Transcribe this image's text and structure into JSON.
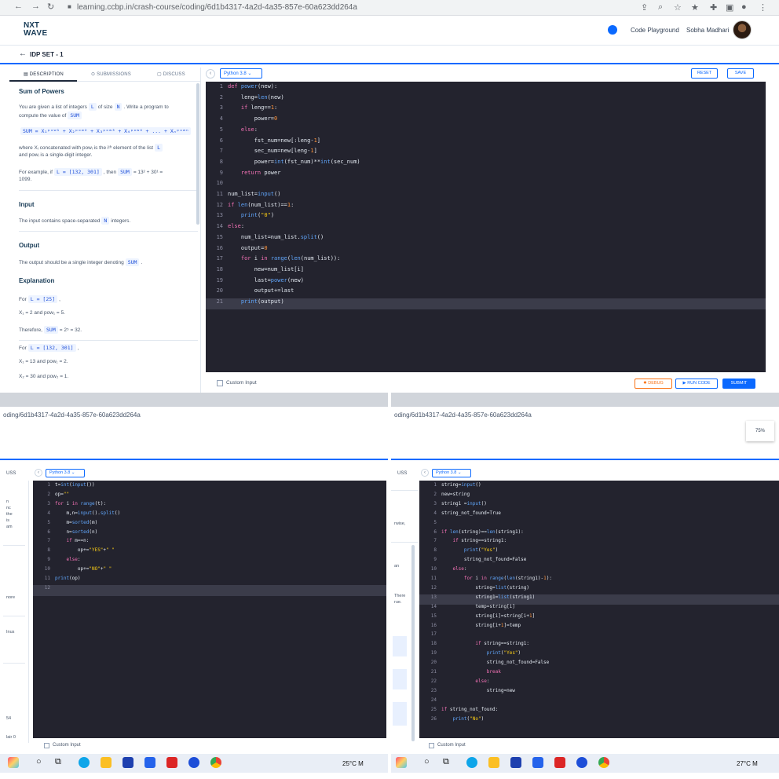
{
  "browser": {
    "url": "learning.ccbp.in/crash-course/coding/6d1b4317-4a2d-4a35-857e-60a623dd264a"
  },
  "header": {
    "logo_line1": "NXT",
    "logo_line2": "WAVE",
    "playground_label": "Code Playground",
    "username": "Sobha Madhari"
  },
  "page": {
    "title": "IDP SET - 1"
  },
  "tabs": [
    {
      "label": "DESCRIPTION"
    },
    {
      "label": "SUBMISSIONS"
    },
    {
      "label": "DISCUSS"
    }
  ],
  "problem": {
    "title": "Sum of Powers",
    "intro_a": "You are given a list of integers",
    "intro_L": "L",
    "intro_b": "of size",
    "intro_N": "N",
    "intro_c": ". Write a program to",
    "intro_d": "compute the value of",
    "intro_SUM": "SUM",
    "formula": "SUM  = X₁ᵖᵒʷ¹ + X₂ᵖᵒʷ² + X₃ᵖᵒʷ³ + X₄ᵖᵒʷ⁴ + ... + Xₙᵖᵒʷⁿ",
    "where_a": "where Xᵢ concatenated with powᵢ is the iᵗʰ element of the list",
    "where_L": "L",
    "where_b": "and powᵢ is a single-digit integer.",
    "example_a": "For example, if",
    "example_L": "L = [132, 301]",
    "example_b": ", then",
    "example_SUM": "SUM",
    "example_c": "= 13² + 30¹ =",
    "example_d": "1099.",
    "input_heading": "Input",
    "input_a": "The input contains space-separated",
    "input_N": "N",
    "input_b": "integers.",
    "output_heading": "Output",
    "output_a": "The output should be a single integer denoting",
    "output_SUM": "SUM",
    "output_b": ".",
    "explanation_heading": "Explanation",
    "exp1_a": "For",
    "exp1_L": "L = [25]",
    "exp1_b": ",",
    "exp2": "X₁ = 2 and pow₁ = 5.",
    "exp3_a": "Therefore,",
    "exp3_SUM": "SUM",
    "exp3_b": "= 2⁵ = 32.",
    "exp4_a": "For",
    "exp4_L": "L = [132, 301]",
    "exp4_b": ",",
    "exp5": "X₁ = 13 and pow₁ = 2.",
    "exp6": "X₂ = 30 and pow₂ = 1."
  },
  "toolbar": {
    "language": "Python 3.8",
    "reset_label": "RESET",
    "save_label": "SAVE"
  },
  "editor_main": {
    "active_line": 21,
    "lines": [
      {
        "n": "1",
        "t": "def power(new):"
      },
      {
        "n": "2",
        "t": "    leng=len(new)"
      },
      {
        "n": "3",
        "t": "    if leng==1:"
      },
      {
        "n": "4",
        "t": "        power=0"
      },
      {
        "n": "5",
        "t": "    else:"
      },
      {
        "n": "6",
        "t": "        fst_num=new[:leng-1]"
      },
      {
        "n": "7",
        "t": "        sec_num=new[leng-1]"
      },
      {
        "n": "8",
        "t": "        power=int(fst_num)**int(sec_num)"
      },
      {
        "n": "9",
        "t": "    return power"
      },
      {
        "n": "10",
        "t": ""
      },
      {
        "n": "11",
        "t": "num_list=input()"
      },
      {
        "n": "12",
        "t": "if len(num_list)==1:"
      },
      {
        "n": "13",
        "t": "    print(\"0\")"
      },
      {
        "n": "14",
        "t": "else:"
      },
      {
        "n": "15",
        "t": "    num_list=num_list.split()"
      },
      {
        "n": "16",
        "t": "    output=0"
      },
      {
        "n": "17",
        "t": "    for i in range(len(num_list)):"
      },
      {
        "n": "18",
        "t": "        new=num_list[i]"
      },
      {
        "n": "19",
        "t": "        last=power(new)"
      },
      {
        "n": "20",
        "t": "        output+=last"
      },
      {
        "n": "21",
        "t": "    print(output)"
      }
    ]
  },
  "footer_main": {
    "custom_input": "Custom Input",
    "debug": "DEBUG",
    "run_code": "▶ RUN CODE",
    "submit": "SUBMIT"
  },
  "mid": {
    "url_left": "oding/6d1b4317-4a2d-4a35-857e-60a623dd264a",
    "url_right": "oding/6d1b4317-4a2d-4a35-857e-60a623dd264a",
    "zoom": "75%"
  },
  "bottom_left": {
    "tab_fragment": "USS",
    "language": "Python 3.8",
    "side_fragments": [
      "n",
      "nc",
      "the",
      "is",
      "am",
      "nore",
      "Inus",
      "54",
      "lair 0"
    ],
    "active_line": 12,
    "lines": [
      {
        "n": "1",
        "t": "t=int(input())"
      },
      {
        "n": "2",
        "t": "op=\"\""
      },
      {
        "n": "3",
        "t": "for i in range(t):"
      },
      {
        "n": "4",
        "t": "    m,n=input().split()"
      },
      {
        "n": "5",
        "t": "    m=sorted(m)"
      },
      {
        "n": "6",
        "t": "    n=sorted(n)"
      },
      {
        "n": "7",
        "t": "    if m==n:"
      },
      {
        "n": "8",
        "t": "        op+=\"YES\"+\" \""
      },
      {
        "n": "9",
        "t": "    else:"
      },
      {
        "n": "10",
        "t": "        op+=\"NO\"+\" \""
      },
      {
        "n": "11",
        "t": "print(op)"
      },
      {
        "n": "12",
        "t": ""
      }
    ],
    "custom_input": "Custom Input"
  },
  "bottom_right": {
    "tab_fragment": "USS",
    "language": "Python 3.8",
    "side_fragments": [
      "rwise,",
      "an",
      "There",
      "rue."
    ],
    "active_line": 13,
    "lines": [
      {
        "n": "1",
        "t": "string=input()"
      },
      {
        "n": "2",
        "t": "new=string"
      },
      {
        "n": "3",
        "t": "string1 =input()"
      },
      {
        "n": "4",
        "t": "string_not_found=True"
      },
      {
        "n": "5",
        "t": ""
      },
      {
        "n": "6",
        "t": "if len(string)==len(string1):"
      },
      {
        "n": "7",
        "t": "    if string==string1:"
      },
      {
        "n": "8",
        "t": "        print(\"Yes\")"
      },
      {
        "n": "9",
        "t": "        string_not_found=False"
      },
      {
        "n": "10",
        "t": "    else:"
      },
      {
        "n": "11",
        "t": "        for i in range(len(string1)-1):"
      },
      {
        "n": "12",
        "t": "            string=list(string)"
      },
      {
        "n": "13",
        "t": "            string1=list(string1)"
      },
      {
        "n": "14",
        "t": "            temp=string[i]"
      },
      {
        "n": "15",
        "t": "            string[i]=string[i+1]"
      },
      {
        "n": "16",
        "t": "            string[i+1]=temp"
      },
      {
        "n": "17",
        "t": ""
      },
      {
        "n": "18",
        "t": "            if string==string1:"
      },
      {
        "n": "19",
        "t": "                print(\"Yes\")"
      },
      {
        "n": "20",
        "t": "                string_not_found=False"
      },
      {
        "n": "21",
        "t": "                break"
      },
      {
        "n": "22",
        "t": "            else:"
      },
      {
        "n": "23",
        "t": "                string=new"
      },
      {
        "n": "24",
        "t": ""
      },
      {
        "n": "25",
        "t": "if string_not_found:"
      },
      {
        "n": "26",
        "t": "    print(\"No\")"
      }
    ],
    "custom_input": "Custom Input"
  },
  "taskbar_left": {
    "weather": "25°C  M"
  },
  "taskbar_right": {
    "weather": "27°C  M"
  },
  "colors": {
    "accent": "#0b69ff",
    "editor_bg": "#23232e",
    "debug": "#f97316",
    "keyword": "#f472b6",
    "string": "#facc15",
    "number": "#fb923c",
    "function": "#60a5fa"
  }
}
